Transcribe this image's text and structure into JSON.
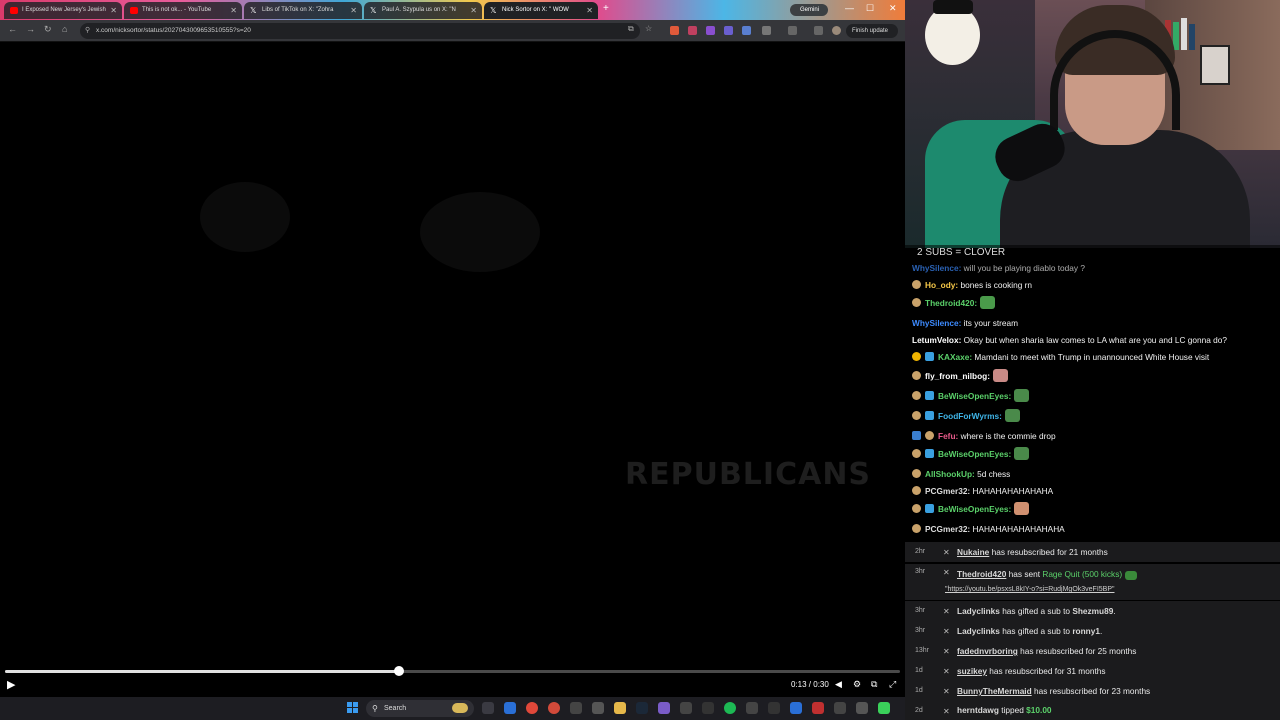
{
  "browser": {
    "tabs": [
      {
        "title": "I Exposed New Jersey's Jewish",
        "favicon_color": "#ff0000"
      },
      {
        "title": "This is not ok... - YouTube",
        "favicon_color": "#ff0000"
      },
      {
        "title": "Libs of TikTok on X: \"Zohra",
        "favicon_color": "#ffffff"
      },
      {
        "title": "Paul A. Szypula us on X: \"N",
        "favicon_color": "#ffffff"
      },
      {
        "title": "Nick Sortor on X: \" WOW",
        "favicon_color": "#ffffff"
      }
    ],
    "new_tab": "+",
    "gemini_label": "Gemini",
    "url": "x.com/nicksortor/status/2027043009653510555?s=20",
    "finish_update_label": "Finish update"
  },
  "video": {
    "ghost_text": "REPUBLICANS",
    "current_time": "0:13",
    "duration": "0:30",
    "timecode": "0:13 / 0:30",
    "progress_fraction": 0.44
  },
  "taskbar": {
    "search_label": "Search"
  },
  "chat": {
    "banner": "2 SUBS = CLOVER",
    "messages": [
      {
        "user": "WhySilence:",
        "text": " will you be playing diablo today ?",
        "color": "#3d8bff",
        "badge": "",
        "emote": ""
      },
      {
        "user": "Ho_ody:",
        "text": " bones is cooking rn",
        "color": "#f7c948",
        "badge": "#c9a26a",
        "emote": ""
      },
      {
        "user": "Thedroid420:",
        "text": "",
        "color": "#5bd16a",
        "badge": "#c9a26a",
        "emote": "#4a9a4a"
      },
      {
        "user": "WhySilence:",
        "text": " its your stream",
        "color": "#3d8bff",
        "badge": "",
        "emote": ""
      },
      {
        "user": "LetumVelox:",
        "text": " Okay but when sharia law comes to LA what are you and LC gonna do?",
        "color": "#ffffff",
        "badge": "",
        "emote": ""
      },
      {
        "user": "KAXaxe:",
        "text": " Mamdani to meet with Trump in unannounced White House visit",
        "color": "#5bd16a",
        "badge": "#f0b400",
        "emote": ""
      },
      {
        "user": "fly_from_nilbog:",
        "text": "",
        "color": "#ffffff",
        "badge": "#c9a26a",
        "emote": "#c98a86"
      },
      {
        "user": "BeWiseOpenEyes:",
        "text": "",
        "color": "#5bd16a",
        "badge": "#3aa0e0",
        "emote": "#4a8a4a"
      },
      {
        "user": "FoodForWyrms:",
        "text": "",
        "color": "#3fb5e8",
        "badge": "#3aa0e0",
        "emote": "#4a8a4a"
      },
      {
        "user": "Fefu:",
        "text": " where is the commie drop",
        "color": "#e85a8a",
        "badge": "#3a7fd0",
        "emote": ""
      },
      {
        "user": "BeWiseOpenEyes:",
        "text": "",
        "color": "#5bd16a",
        "badge": "#3aa0e0",
        "emote": "#4a8a4a"
      },
      {
        "user": "AllShookUp:",
        "text": " 5d chess",
        "color": "#5bd16a",
        "badge": "",
        "emote": ""
      },
      {
        "user": "PCGmer32:",
        "text": " HAHAHAHAHAHAHA",
        "color": "#dddddd",
        "badge": "#c9a26a",
        "emote": ""
      },
      {
        "user": "BeWiseOpenEyes:",
        "text": "",
        "color": "#5bd16a",
        "badge": "#3aa0e0",
        "emote": "#d09070"
      },
      {
        "user": "PCGmer32:",
        "text": " HAHAHAHAHAHAHAHA",
        "color": "#dddddd",
        "badge": "#c9a26a",
        "emote": ""
      }
    ],
    "events": [
      {
        "time": "2hr",
        "user": "Nukaine",
        "text": " has resubscribed for 21 months",
        "extra": "",
        "extra2": ""
      },
      {
        "time": "3hr",
        "user": "Thedroid420",
        "text": " has sent ",
        "extra": "Rage Quit (500 kicks)",
        "extra2": "\"https://youtu.be/psxsL8kIY-o?si=RudjMgOk3veFI5BP\""
      },
      {
        "time": "3hr",
        "user": "Ladyclinks",
        "text": " has gifted a sub to ",
        "extra": "Shezmu89",
        "extra2": "."
      },
      {
        "time": "3hr",
        "user": "Ladyclinks",
        "text": " has gifted a sub to ",
        "extra": "ronny1",
        "extra2": "."
      },
      {
        "time": "13hr",
        "user": "fadednvrboring",
        "text": " has resubscribed for 25 months",
        "extra": "",
        "extra2": ""
      },
      {
        "time": "1d",
        "user": "suzikey",
        "text": " has resubscribed for 31 months",
        "extra": "",
        "extra2": ""
      },
      {
        "time": "1d",
        "user": "BunnyTheMermaid",
        "text": " has resubscribed for 23 months",
        "extra": "",
        "extra2": ""
      },
      {
        "time": "2d",
        "user": "herntdawg",
        "text": " tipped ",
        "extra": "$10.00",
        "extra2": ""
      }
    ]
  }
}
